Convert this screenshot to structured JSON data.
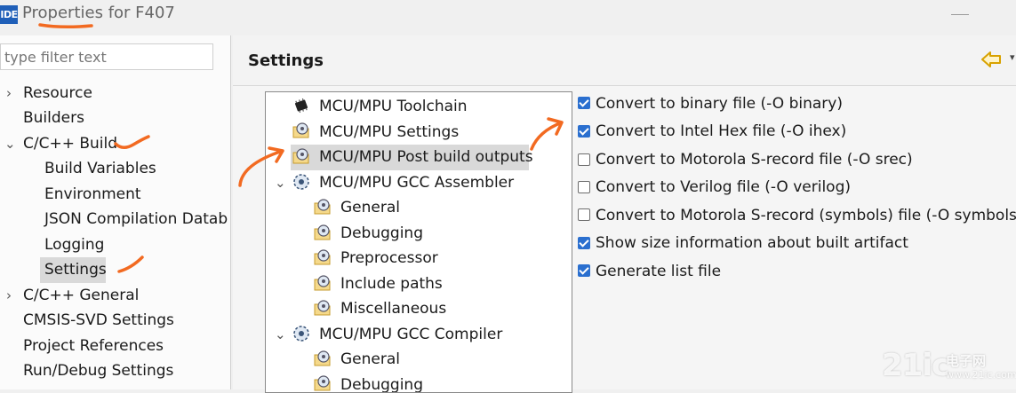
{
  "window": {
    "app_icon_text": "IDE",
    "title": "Properties for F407"
  },
  "sidebar": {
    "filter_placeholder": "type filter text",
    "items": [
      {
        "label": "Resource",
        "twisty": ">"
      },
      {
        "label": "Builders"
      },
      {
        "label": "C/C++ Build",
        "twisty": "v"
      },
      {
        "label": "Build Variables"
      },
      {
        "label": "Environment"
      },
      {
        "label": "JSON Compilation Datab"
      },
      {
        "label": "Logging"
      },
      {
        "label": "Settings"
      },
      {
        "label": "C/C++ General",
        "twisty": ">"
      },
      {
        "label": "CMSIS-SVD Settings"
      },
      {
        "label": "Project References"
      },
      {
        "label": "Run/Debug Settings"
      }
    ]
  },
  "page": {
    "title": "Settings"
  },
  "tree": {
    "items": [
      {
        "label": "MCU/MPU Toolchain",
        "icon": "chip-icon"
      },
      {
        "label": "MCU/MPU Settings",
        "icon": "folder-gear-icon"
      },
      {
        "label": "MCU/MPU Post build outputs",
        "icon": "folder-gear-icon"
      },
      {
        "label": "MCU/MPU GCC Assembler",
        "icon": "gear-icon",
        "twisty": "v"
      },
      {
        "label": "General",
        "icon": "folder-gear-icon"
      },
      {
        "label": "Debugging",
        "icon": "folder-gear-icon"
      },
      {
        "label": "Preprocessor",
        "icon": "folder-gear-icon"
      },
      {
        "label": "Include paths",
        "icon": "folder-gear-icon"
      },
      {
        "label": "Miscellaneous",
        "icon": "folder-gear-icon"
      },
      {
        "label": "MCU/MPU GCC Compiler",
        "icon": "gear-icon",
        "twisty": "v"
      },
      {
        "label": "General",
        "icon": "folder-gear-icon"
      },
      {
        "label": "Debugging",
        "icon": "folder-gear-icon"
      }
    ]
  },
  "options": [
    {
      "label": "Convert to binary file (-O binary)",
      "checked": true
    },
    {
      "label": "Convert to Intel Hex file (-O ihex)",
      "checked": true
    },
    {
      "label": "Convert to Motorola S-record file (-O srec)",
      "checked": false
    },
    {
      "label": "Convert to Verilog file (-O verilog)",
      "checked": false
    },
    {
      "label": "Convert to Motorola S-record (symbols) file (-O symbolsrec)",
      "checked": false
    },
    {
      "label": "Show size information about built artifact",
      "checked": true
    },
    {
      "label": "Generate list file",
      "checked": true
    }
  ],
  "watermark": {
    "logo": "21ic",
    "name": "电子网",
    "url": "www.21ic.com"
  },
  "colors": {
    "annotation": "#f26a21",
    "checkbox": "#2a6fcf",
    "selection": "#d9d9d9"
  }
}
